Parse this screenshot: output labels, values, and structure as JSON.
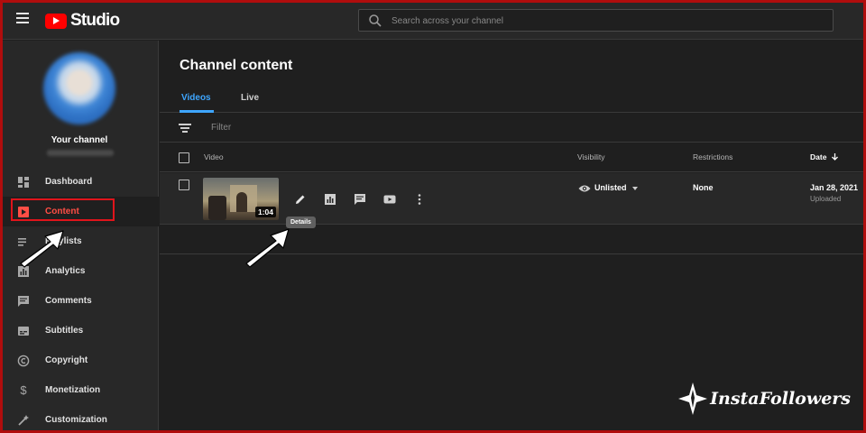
{
  "app": {
    "logo_text": "Studio"
  },
  "search": {
    "placeholder": "Search across your channel"
  },
  "sidebar": {
    "channel_label": "Your channel",
    "items": [
      {
        "label": "Dashboard",
        "icon": "dashboard-icon",
        "active": false
      },
      {
        "label": "Content",
        "icon": "content-icon",
        "active": true
      },
      {
        "label": "Playlists",
        "icon": "playlists-icon",
        "active": false
      },
      {
        "label": "Analytics",
        "icon": "analytics-icon",
        "active": false
      },
      {
        "label": "Comments",
        "icon": "comments-icon",
        "active": false
      },
      {
        "label": "Subtitles",
        "icon": "subtitles-icon",
        "active": false
      },
      {
        "label": "Copyright",
        "icon": "copyright-icon",
        "active": false
      },
      {
        "label": "Monetization",
        "icon": "monetization-icon",
        "active": false
      },
      {
        "label": "Customization",
        "icon": "customization-icon",
        "active": false
      }
    ]
  },
  "main": {
    "title": "Channel content",
    "tabs": [
      {
        "label": "Videos",
        "active": true
      },
      {
        "label": "Live",
        "active": false
      }
    ],
    "filter_placeholder": "Filter",
    "columns": {
      "video": "Video",
      "visibility": "Visibility",
      "restrictions": "Restrictions",
      "date": "Date"
    },
    "rows": [
      {
        "duration": "1:04",
        "visibility": "Unlisted",
        "restrictions": "None",
        "date": "Jan 28, 2021",
        "date_status": "Uploaded"
      }
    ],
    "tooltip": "Details"
  },
  "watermark": {
    "text": "InstaFollowers"
  },
  "colors": {
    "accent_blue": "#3ea6ff",
    "active_red": "#ff4e45",
    "highlight_border": "#e0141b",
    "frame_border": "#b00d0d"
  }
}
